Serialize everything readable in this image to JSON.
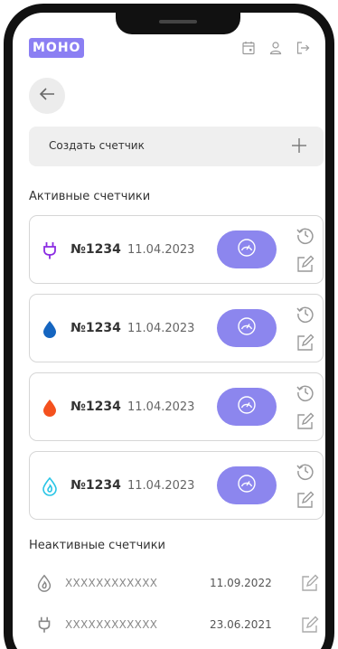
{
  "header": {
    "logo": "МОНО"
  },
  "create": {
    "label": "Создать счетчик"
  },
  "active": {
    "title": "Активные счетчики",
    "items": [
      {
        "number": "№1234",
        "date": "11.04.2023",
        "icon": "plug-icon",
        "color": "#8a2be2"
      },
      {
        "number": "№1234",
        "date": "11.04.2023",
        "icon": "water-drop-icon",
        "color": "#1565c0"
      },
      {
        "number": "№1234",
        "date": "11.04.2023",
        "icon": "hot-water-drop-icon",
        "color": "#f4511e"
      },
      {
        "number": "№1234",
        "date": "11.04.2023",
        "icon": "gas-drop-icon",
        "color": "#29c5e6"
      }
    ]
  },
  "inactive": {
    "title": "Неактивные счетчики",
    "items": [
      {
        "code": "XXXXXXXXXXXX",
        "date": "11.09.2022",
        "icon": "gas-drop-icon"
      },
      {
        "code": "XXXXXXXXXXXX",
        "date": "23.06.2021",
        "icon": "plug-icon"
      }
    ]
  },
  "colors": {
    "accent": "#8c86ee",
    "logo": "#8b7ff3"
  }
}
